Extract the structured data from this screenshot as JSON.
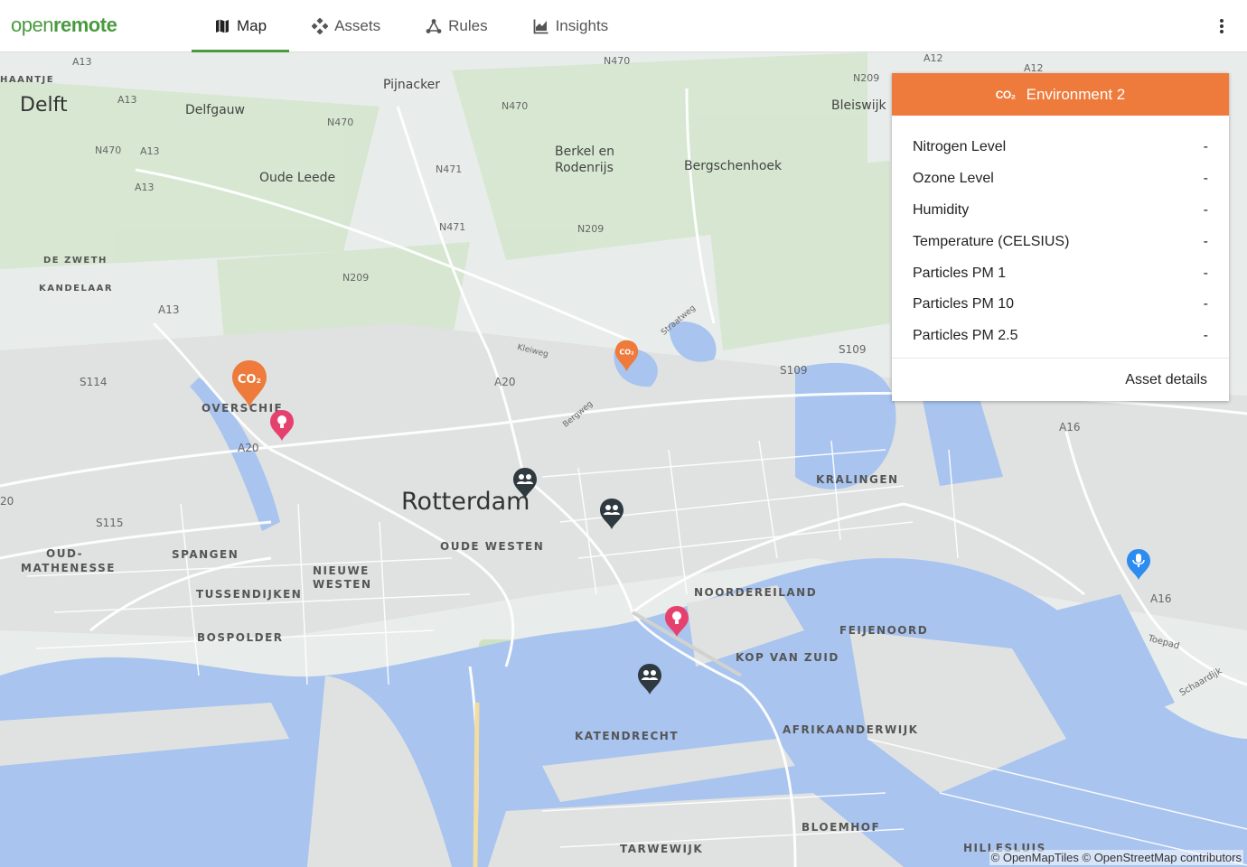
{
  "header": {
    "logo_open": "open",
    "logo_remote": "remote",
    "nav": [
      {
        "label": "Map",
        "icon": "map-icon",
        "active": true
      },
      {
        "label": "Assets",
        "icon": "assets-icon"
      },
      {
        "label": "Rules",
        "icon": "rules-icon"
      },
      {
        "label": "Insights",
        "icon": "insights-icon"
      }
    ]
  },
  "map": {
    "labels": {
      "delft": "Delft",
      "delfgauw": "Delfgauw",
      "pijnacker": "Pijnacker",
      "oude_leede": "Oude Leede",
      "berkel": "Berkel en",
      "rodenrijs": "Rodenrijs",
      "bergschenhoek": "Bergschenhoek",
      "bleiswijk": "Bleiswijk",
      "rotterdam": "Rotterdam",
      "de_zweth": "DE ZWETH",
      "kandelaar": "KANDELAAR",
      "overschie": "OVERSCHIE",
      "kralingen": "KRALINGEN",
      "oude_westen": "OUDE WESTEN",
      "spangen": "SPANGEN",
      "oud_1": "OUD-",
      "oud_2": "MATHENESSE",
      "nieuwe_1": "NIEUWE",
      "nieuwe_2": "WESTEN",
      "tussendijken": "TUSSENDIJKEN",
      "bospolder": "BOSPOLDER",
      "noordereiland": "NOORDEREILAND",
      "feijenoord": "FEIJENOORD",
      "kop_van_zuid": "KOP VAN ZUID",
      "afrikaanderwijk": "AFRIKAANDERWIJK",
      "katendrecht": "KATENDRECHT",
      "bloemhof": "BLOEMHOF",
      "tarwewijk": "TARWEWIJK",
      "hillesluis": "HILLESLUIS",
      "haantje": "HAANTJE",
      "a13_1": "A13",
      "a13_2": "A13",
      "a13_3": "A13",
      "a13_4": "A13",
      "a13_5": "A13",
      "a12_1": "A12",
      "a12_2": "A12",
      "n470_1": "N470",
      "n470_2": "N470",
      "n470_3": "N470",
      "n470_4": "N470",
      "n471_1": "N471",
      "n471_2": "N471",
      "n209_1": "N209",
      "n209_2": "N209",
      "n209_3": "N209",
      "s114": "S114",
      "s115": "S115",
      "s109_1": "S109",
      "s109_2": "S109",
      "a20_1": "A20",
      "a20_2": "A20",
      "a20_3": "20",
      "a16_1": "A16",
      "a16_2": "A16",
      "kleiweg": "Kleiweg",
      "bergweg": "Bergweg",
      "toepad": "Toepad",
      "schaardijk": "Schaardijk",
      "straatweg": "Straatweg"
    },
    "attribution": "© OpenMapTiles © OpenStreetMap contributors"
  },
  "panel": {
    "title": "Environment 2",
    "icon_text": "CO₂",
    "attributes": [
      {
        "name": "Nitrogen Level",
        "value": "-"
      },
      {
        "name": "Ozone Level",
        "value": "-"
      },
      {
        "name": "Humidity",
        "value": "-"
      },
      {
        "name": "Temperature (CELSIUS)",
        "value": "-"
      },
      {
        "name": "Particles PM 1",
        "value": "-"
      },
      {
        "name": "Particles PM 10",
        "value": "-"
      },
      {
        "name": "Particles PM 2.5",
        "value": "-"
      }
    ],
    "footer_link": "Asset details"
  },
  "markers": {
    "co2_text": "CO₂"
  },
  "colors": {
    "brand_green": "#4a9a3f",
    "co2_marker": "#ee7b3b",
    "light_marker": "#e6416e",
    "people_marker": "#2f3a40",
    "mic_marker": "#2d8cf0",
    "water": "#a9c4ef",
    "land": "#e8ecea",
    "green": "#cfe3c7"
  }
}
